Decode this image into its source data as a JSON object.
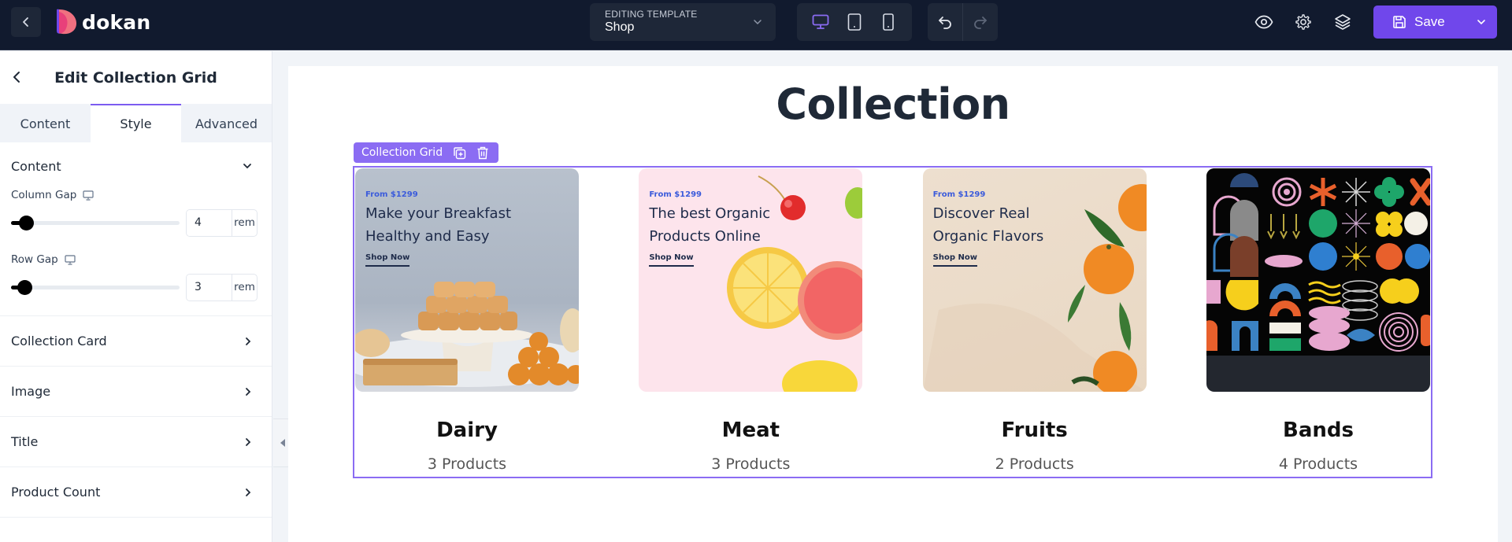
{
  "topbar": {
    "back_label": "Back",
    "logo_text": "dokan",
    "template": {
      "label": "EDITING TEMPLATE",
      "value": "Shop"
    },
    "devices": [
      {
        "name": "desktop",
        "active": true
      },
      {
        "name": "tablet",
        "active": false
      },
      {
        "name": "mobile",
        "active": false
      }
    ],
    "undo_label": "Undo",
    "redo_label": "Redo",
    "save_label": "Save",
    "colors": {
      "accent": "#7047eb",
      "bar_bg": "#111a2e"
    }
  },
  "panel": {
    "title": "Edit Collection Grid",
    "tabs": [
      {
        "label": "Content",
        "active": false
      },
      {
        "label": "Style",
        "active": true
      },
      {
        "label": "Advanced",
        "active": false
      }
    ],
    "content_section": {
      "title": "Content",
      "column_gap": {
        "label": "Column Gap",
        "value": "4",
        "unit": "rem",
        "slider_fraction": 0.05
      },
      "row_gap": {
        "label": "Row Gap",
        "value": "3",
        "unit": "rem",
        "slider_fraction": 0.04
      }
    },
    "sections": [
      {
        "title": "Collection Card"
      },
      {
        "title": "Image"
      },
      {
        "title": "Title"
      },
      {
        "title": "Product Count"
      }
    ]
  },
  "canvas": {
    "heading": "Collection",
    "selection": {
      "label": "Collection Grid"
    },
    "cards": [
      {
        "title": "Dairy",
        "count": "3 Products",
        "banner": {
          "from": "From $1299",
          "line1": "Make your Breakfast",
          "line2": "Healthy and Easy",
          "cta": "Shop Now"
        }
      },
      {
        "title": "Meat",
        "count": "3 Products",
        "banner": {
          "from": "From $1299",
          "line1": "The best Organic",
          "line2": "Products Online",
          "cta": "Shop Now"
        }
      },
      {
        "title": "Fruits",
        "count": "2 Products",
        "banner": {
          "from": "From $1299",
          "line1": "Discover Real",
          "line2": "Organic Flavors",
          "cta": "Shop Now"
        }
      },
      {
        "title": "Bands",
        "count": "4 Products"
      }
    ]
  }
}
